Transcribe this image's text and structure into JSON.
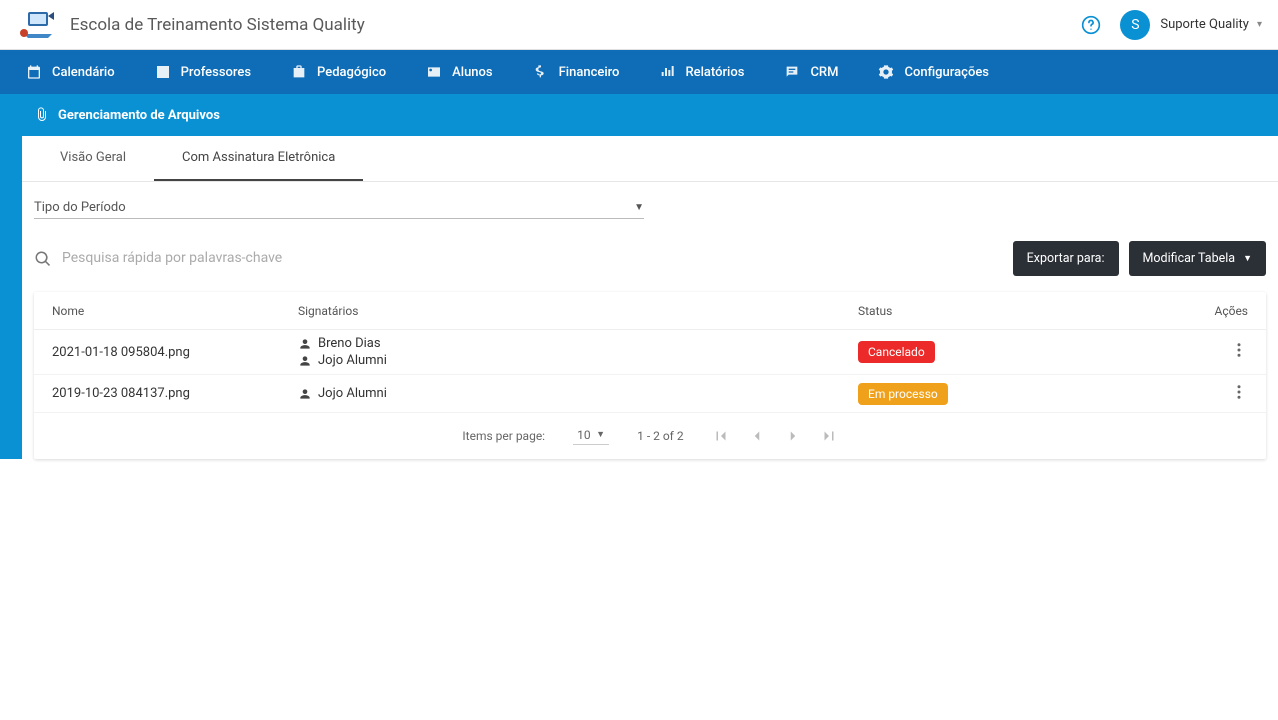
{
  "header": {
    "app_title": "Escola de Treinamento Sistema Quality",
    "user_initial": "S",
    "user_name": "Suporte Quality"
  },
  "nav": {
    "items": [
      {
        "label": "Calendário"
      },
      {
        "label": "Professores"
      },
      {
        "label": "Pedagógico"
      },
      {
        "label": "Alunos"
      },
      {
        "label": "Financeiro"
      },
      {
        "label": "Relatórios"
      },
      {
        "label": "CRM"
      },
      {
        "label": "Configurações"
      }
    ]
  },
  "subheader": {
    "title": "Gerenciamento de Arquivos"
  },
  "tabs": {
    "t0": "Visão Geral",
    "t1": "Com Assinatura Eletrônica"
  },
  "filter": {
    "period_label": "Tipo do Período"
  },
  "search": {
    "placeholder": "Pesquisa rápida por palavras-chave"
  },
  "buttons": {
    "export": "Exportar para:",
    "modify": "Modificar Tabela"
  },
  "table": {
    "headers": {
      "name": "Nome",
      "signers": "Signatários",
      "status": "Status",
      "actions": "Ações"
    },
    "rows": [
      {
        "name": "2021-01-18 095804.png",
        "signers": [
          "Breno Dias",
          "Jojo Alumni"
        ],
        "status": "Cancelado",
        "status_color": "red"
      },
      {
        "name": "2019-10-23 084137.png",
        "signers": [
          "Jojo Alumni"
        ],
        "status": "Em processo",
        "status_color": "orange"
      }
    ]
  },
  "paginator": {
    "items_per_page_label": "Items per page:",
    "page_size": "10",
    "range": "1 - 2 of 2"
  }
}
